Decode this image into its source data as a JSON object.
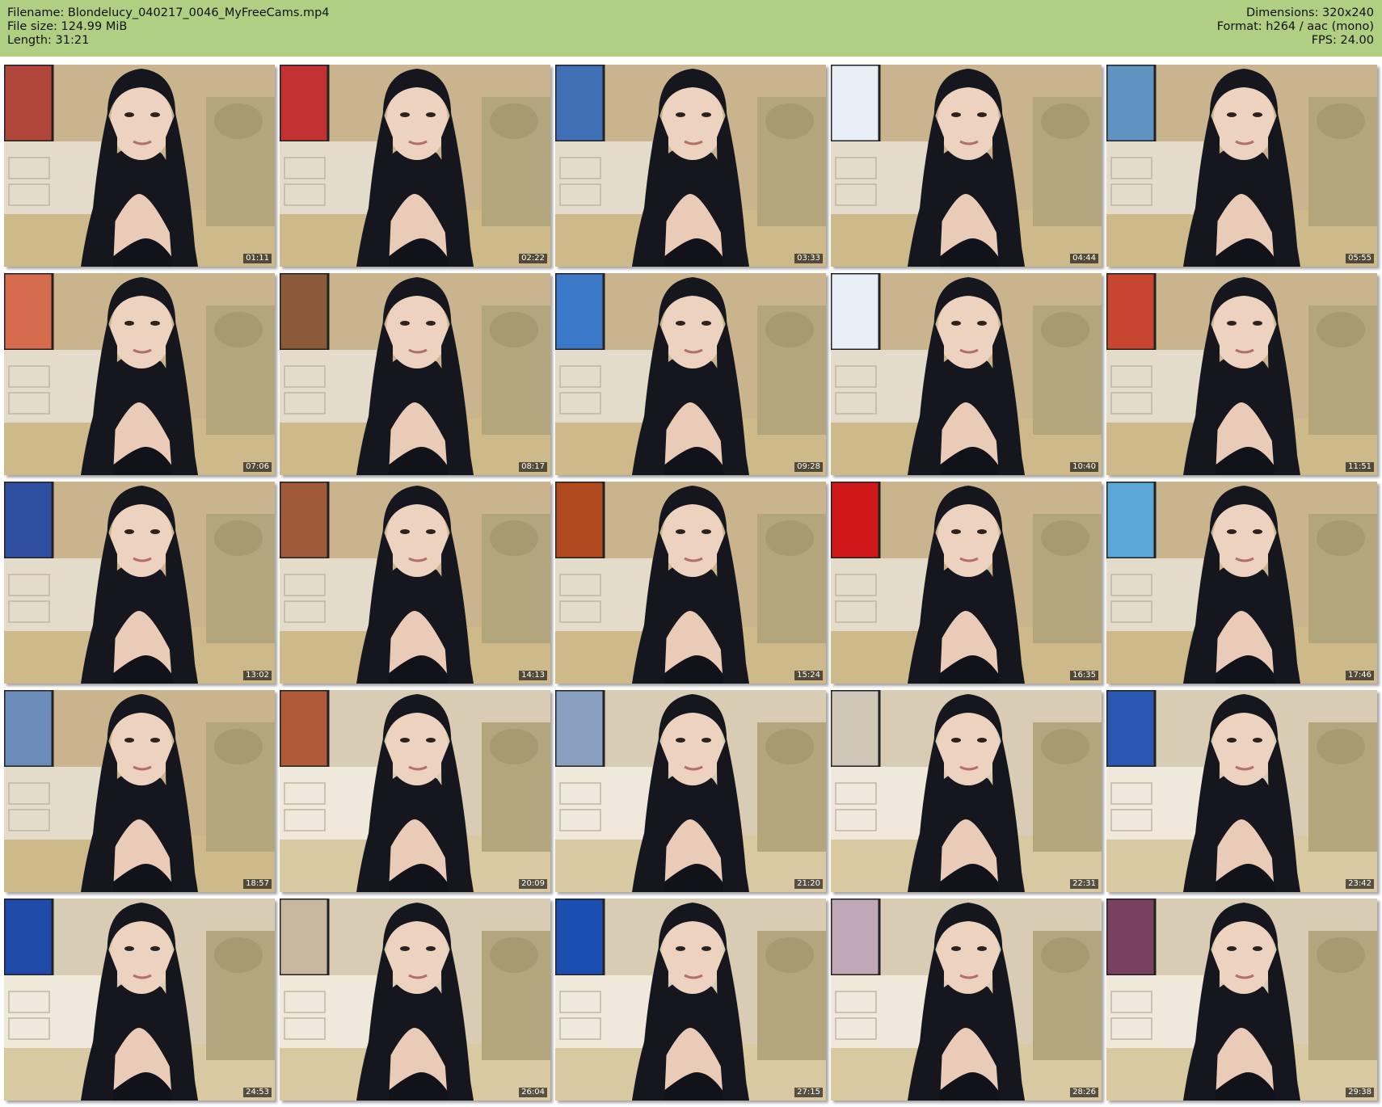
{
  "header": {
    "filename_line": "Filename: Blondelucy_040217_0046_MyFreeCams.mp4",
    "filesize_line": "File size: 124.99 MiB",
    "length_line": "Length: 31:21",
    "dimensions_line": "Dimensions: 320x240",
    "format_line": "Format: h264 / aac (mono)",
    "fps_line": "FPS: 24.00"
  },
  "colors": {
    "header_bg": "#b0cf83",
    "page_bg": "#ffffff"
  },
  "thumbnails": [
    {
      "timestamp": "01:11",
      "tv": "#b0473a"
    },
    {
      "timestamp": "02:22",
      "tv": "#c23232"
    },
    {
      "timestamp": "03:33",
      "tv": "#3f6fb5"
    },
    {
      "timestamp": "04:44",
      "tv": "#e8eef5"
    },
    {
      "timestamp": "05:55",
      "tv": "#5e93c2"
    },
    {
      "timestamp": "07:06",
      "tv": "#d66b4d"
    },
    {
      "timestamp": "08:17",
      "tv": "#8a5a3a"
    },
    {
      "timestamp": "09:28",
      "tv": "#3b78c8"
    },
    {
      "timestamp": "10:40",
      "tv": "#e7eef6"
    },
    {
      "timestamp": "11:51",
      "tv": "#c8452f"
    },
    {
      "timestamp": "13:02",
      "tv": "#2f4fa0"
    },
    {
      "timestamp": "14:13",
      "tv": "#a05a3a"
    },
    {
      "timestamp": "15:24",
      "tv": "#b04a1e"
    },
    {
      "timestamp": "16:35",
      "tv": "#d01818"
    },
    {
      "timestamp": "17:46",
      "tv": "#5aa7d8"
    },
    {
      "timestamp": "18:57",
      "tv": "#6b8cb8"
    },
    {
      "timestamp": "20:09",
      "tv": "#b05a3a"
    },
    {
      "timestamp": "21:20",
      "tv": "#8aa0c0"
    },
    {
      "timestamp": "22:31",
      "tv": "#cfc8b8"
    },
    {
      "timestamp": "23:42",
      "tv": "#2a57b0"
    },
    {
      "timestamp": "24:53",
      "tv": "#1f4aa8"
    },
    {
      "timestamp": "26:04",
      "tv": "#c8b8a0"
    },
    {
      "timestamp": "27:15",
      "tv": "#1a4fb0"
    },
    {
      "timestamp": "28:26",
      "tv": "#c0a8b8"
    },
    {
      "timestamp": "29:38",
      "tv": "#7a4060"
    }
  ]
}
